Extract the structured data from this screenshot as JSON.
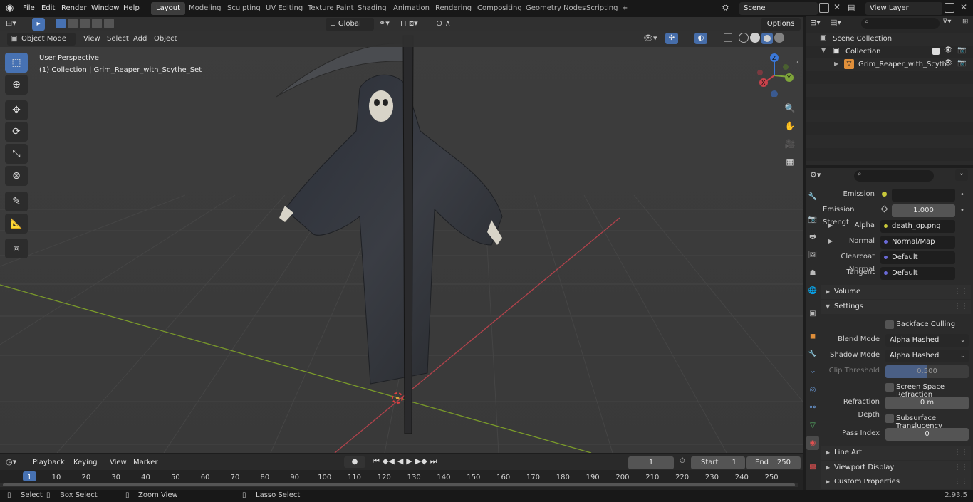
{
  "topbar": {
    "menu": [
      "File",
      "Edit",
      "Render",
      "Window",
      "Help"
    ],
    "workspaces": [
      "Layout",
      "Modeling",
      "Sculpting",
      "UV Editing",
      "Texture Paint",
      "Shading",
      "Animation",
      "Rendering",
      "Compositing",
      "Geometry Nodes",
      "Scripting"
    ],
    "active_workspace": "Layout",
    "add_workspace": "+",
    "scene": "Scene",
    "view_layer": "View Layer"
  },
  "viewport_header": {
    "mode": "Object Mode",
    "menus": [
      "View",
      "Select",
      "Add",
      "Object"
    ],
    "orientation": "Global",
    "options": "Options"
  },
  "viewport": {
    "perspective": "User Perspective",
    "collection_info": "(1) Collection | Grim_Reaper_with_Scythe_Set",
    "gizmo": {
      "x": "X",
      "y": "Y",
      "z": "Z"
    }
  },
  "outliner": {
    "scene_collection": "Scene Collection",
    "collection": "Collection",
    "object": "Grim_Reaper_with_Scyth"
  },
  "properties": {
    "emission_label": "Emission",
    "emission_strength_label": "Emission Strengt",
    "emission_strength_value": "1.000",
    "alpha_label": "Alpha",
    "alpha_value": "death_op.png",
    "normal_label": "Normal",
    "normal_value": "Normal/Map",
    "clearcoat_label": "Clearcoat Normal",
    "clearcoat_value": "Default",
    "tangent_label": "Tangent",
    "tangent_value": "Default",
    "volume_panel": "Volume",
    "settings_panel": "Settings",
    "backface_culling": "Backface Culling",
    "blend_mode_label": "Blend Mode",
    "blend_mode_value": "Alpha Hashed",
    "shadow_mode_label": "Shadow Mode",
    "shadow_mode_value": "Alpha Hashed",
    "clip_threshold_label": "Clip Threshold",
    "clip_threshold_value": "0.500",
    "screen_space_refraction": "Screen Space Refraction",
    "refraction_depth_label": "Refraction Depth",
    "refraction_depth_value": "0 m",
    "subsurface_translucency": "Subsurface Translucency",
    "pass_index_label": "Pass Index",
    "pass_index_value": "0",
    "line_art_panel": "Line Art",
    "viewport_display_panel": "Viewport Display",
    "custom_properties_panel": "Custom Properties"
  },
  "timeline": {
    "menus": [
      "Playback",
      "Keying",
      "View",
      "Marker"
    ],
    "current_frame": "1",
    "start_label": "Start",
    "start_value": "1",
    "end_label": "End",
    "end_value": "250",
    "ticks": [
      "1",
      "10",
      "20",
      "30",
      "40",
      "50",
      "60",
      "70",
      "80",
      "90",
      "100",
      "110",
      "120",
      "130",
      "140",
      "150",
      "160",
      "170",
      "180",
      "190",
      "200",
      "210",
      "220",
      "230",
      "240",
      "250"
    ]
  },
  "statusbar": {
    "select": "Select",
    "box_select": "Box Select",
    "zoom_view": "Zoom View",
    "lasso_select": "Lasso Select",
    "version": "2.93.5"
  },
  "colors": {
    "accent": "#4772b3",
    "x_axis": "#c8424b",
    "y_axis": "#7ea43a",
    "z_axis": "#3b78d8"
  }
}
